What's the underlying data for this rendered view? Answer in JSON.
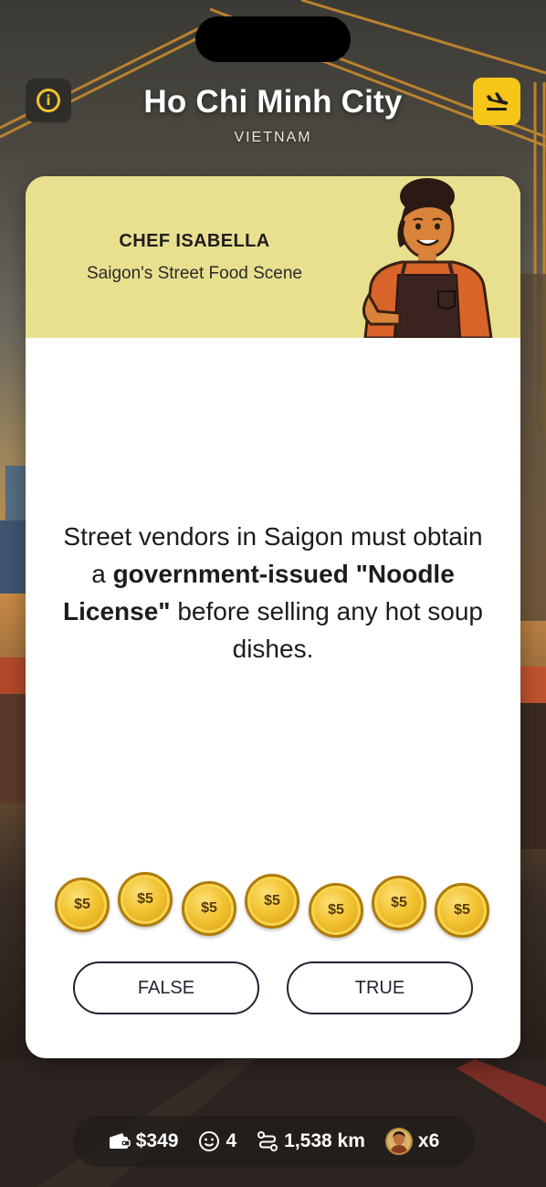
{
  "header": {
    "city": "Ho Chi Minh City",
    "country": "VIETNAM"
  },
  "icons": {
    "info": "info-icon",
    "fly": "airplane-landing-icon",
    "wallet": "wallet-icon",
    "smiley": "smiley-icon",
    "route": "route-icon"
  },
  "colors": {
    "accent": "#f5c518",
    "card_header": "#e8e08f",
    "coin": "#f2c230"
  },
  "guide": {
    "name": "CHEF ISABELLA",
    "topic": "Saigon's Street Food Scene"
  },
  "statement": {
    "part1": "Street vendors in Saigon must obtain a ",
    "bold": "government-issued \"Noodle License\"",
    "part2": " before selling any hot soup dishes."
  },
  "bets": {
    "coins": [
      "$5",
      "$5",
      "$5",
      "$5",
      "$5",
      "$5",
      "$5"
    ]
  },
  "answers": {
    "false_label": "FALSE",
    "true_label": "TRUE"
  },
  "status": {
    "money": "$349",
    "smiles": "4",
    "distance": "1,538 km",
    "multiplier": "x6"
  }
}
